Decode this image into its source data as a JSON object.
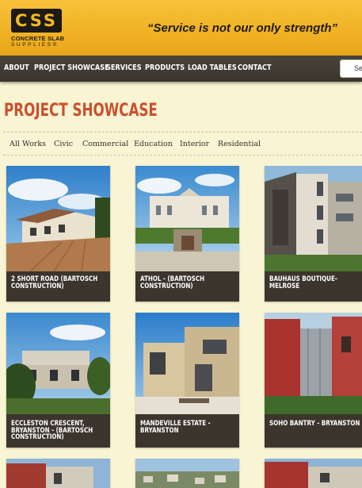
{
  "header": {
    "logo_letters": "CSS",
    "logo_line1": "CONCRETE SLAB",
    "logo_line2": "SUPPLIES®",
    "tagline": "“Service is not our only strength”"
  },
  "nav": {
    "items": [
      "ABOUT",
      "PROJECT SHOWCASE",
      "SERVICES",
      "PRODUCTS",
      "LOAD TABLES",
      "CONTACT"
    ],
    "search_text": "Se"
  },
  "page_title": "PROJECT SHOWCASE",
  "filters": [
    "All Works",
    "Civic",
    "Commercial",
    "Education",
    "Interior",
    "Residential"
  ],
  "projects": [
    {
      "caption": "2 SHORT ROAD (BARTOSCH\nCONSTRUCTION)"
    },
    {
      "caption": "ATHOL - (BARTOSCH\nCONSTRUCTION)"
    },
    {
      "caption": "BAUHAUS BOUTIQUE-MELROSE"
    },
    {
      "caption": "ECCLESTON CRESCENT,\nBRYANSTON - (BARTOSCH\nCONSTRUCTION)"
    },
    {
      "caption": "MANDEVILLE ESTATE -\nBRYANSTON"
    },
    {
      "caption": "SOHO BANTRY - BRYANSTON"
    }
  ],
  "colors": {
    "header_yellow": "#f1b325",
    "nav_dark": "#3a352e",
    "page_bg": "#f8f4d4",
    "title_orange": "#c9502d",
    "card_dark": "#3b352d"
  }
}
